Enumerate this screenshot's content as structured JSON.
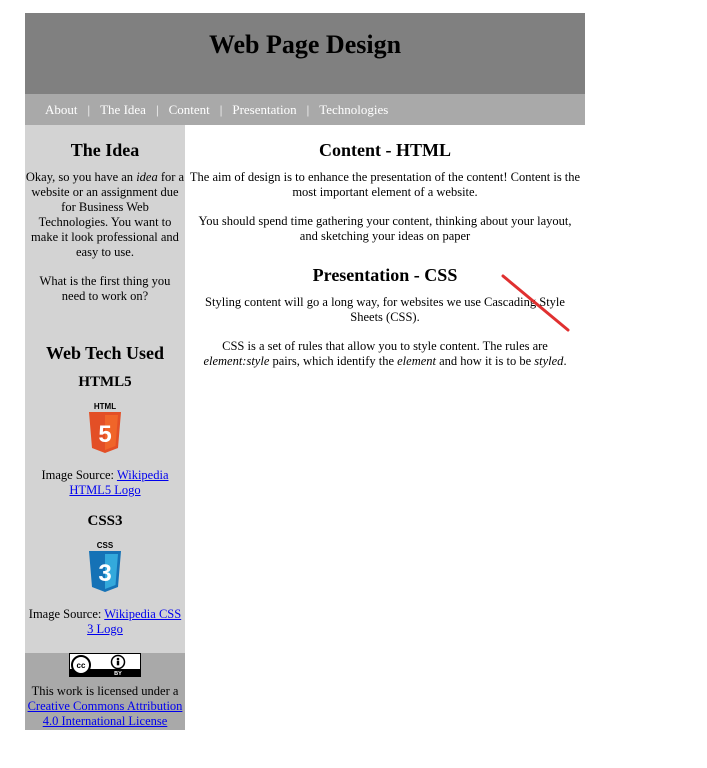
{
  "header": {
    "title": "Web Page Design"
  },
  "nav": {
    "items": [
      "About",
      "The Idea",
      "Content",
      "Presentation",
      "Technologies"
    ],
    "separator": "|"
  },
  "sidebar": {
    "idea_heading": "The Idea",
    "idea_text_before": "Okay, so you have an ",
    "idea_em": "idea",
    "idea_text_after": " for a website or an assignment due for Business Web Technologies. You want to make it look professional and easy to use.",
    "question": "What is the first thing you need to work on?",
    "tech_heading": "Web Tech Used",
    "html5": {
      "heading": "HTML5",
      "badge_label": "HTML",
      "badge_number": "5",
      "source_label": "Image Source: ",
      "source_link": "Wikipedia HTML5 Logo"
    },
    "css3": {
      "heading": "CSS3",
      "badge_label": "CSS",
      "badge_number": "3",
      "source_label": "Image Source: ",
      "source_link": "Wikipedia CSS 3 Logo"
    },
    "license": {
      "badge_by": "BY",
      "text": "This work is licensed under a ",
      "link": "Creative Commons Attribution 4.0 International License"
    }
  },
  "main": {
    "content_heading": "Content - HTML",
    "content_p1": "The aim of design is to enhance the presentation of the content! Content is the most important element of a website.",
    "content_p2": "You should spend time gathering your content, thinking about your layout, and sketching your ideas on paper",
    "presentation_heading": "Presentation - CSS",
    "presentation_p1": "Styling content will go a long way, for websites we use Cascading Style Sheets (CSS).",
    "p2_a": "CSS is a set of rules that allow you to style content. The rules are ",
    "p2_em1": "element:style",
    "p2_b": " pairs, which identify the ",
    "p2_em2": "element",
    "p2_c": " and how it is to be ",
    "p2_em3": "styled",
    "p2_d": "."
  },
  "colors": {
    "header_bg": "#808080",
    "nav_bg": "#a9a9a9",
    "sidebar_bg": "#d3d3d3",
    "html5_orange": "#e34f26",
    "css3_blue": "#1572b6",
    "annotation_red": "#e03030"
  }
}
